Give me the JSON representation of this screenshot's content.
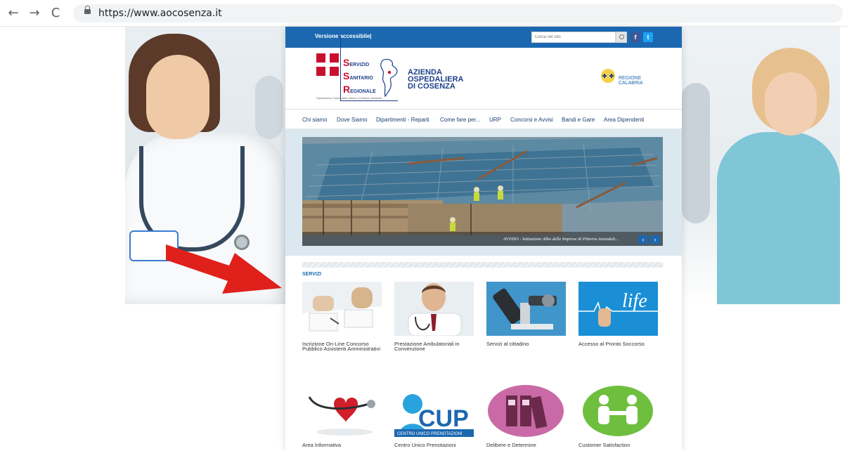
{
  "browser": {
    "url": "https://www.aocosenza.it",
    "back_icon": "←",
    "forward_icon": "→",
    "reload_icon": "C"
  },
  "topbar": {
    "accessible_link": "Versione accessibile|",
    "search_placeholder": "Cerca nel sito",
    "facebook_glyph": "f",
    "twitter_glyph": "t"
  },
  "header": {
    "ssr": {
      "line1_initial": "S",
      "line1_rest": "ERVIZIO",
      "line2_initial": "S",
      "line2_rest": "ANITARIO",
      "line3_initial": "R",
      "line3_rest": "EGIONALE",
      "subtitle": "Dipartimento Tutela della Salute e Politiche Sanitarie"
    },
    "azienda": [
      "AZIENDA",
      "OSPEDALIERA",
      "DI COSENZA"
    ],
    "regione": [
      "REGIONE",
      "CALABRIA"
    ]
  },
  "menu": [
    "Chi siamo",
    "Dove Siamo",
    "Dipartimenti - Reparti",
    "Come fare per...",
    "URP",
    "Concorsi e Avvisi",
    "Bandi e Gare",
    "Area Dipendenti"
  ],
  "slider": {
    "caption": "AVVISO - Istituzione Albo delle Imprese di Pittoria Aziendali...",
    "prev_glyph": "‹",
    "next_glyph": "›"
  },
  "services": {
    "title": "SERVIZI",
    "items": [
      {
        "label": "Iscrizione On-Line Concorso Pubblico Assistenti Amministrativi",
        "icon": "documents-signing-icon"
      },
      {
        "label": "Prestazione Ambulatoriali in Convenzione",
        "icon": "doctor-portrait-icon"
      },
      {
        "label": "Servizi al cittadino",
        "icon": "microscope-icon"
      },
      {
        "label": "Accesso al Pronto Soccorso",
        "icon": "life-heartbeat-icon"
      },
      {
        "label": "Area Informativa",
        "icon": "heart-stethoscope-icon"
      },
      {
        "label": "Centro Unico Prenotazioni",
        "icon": "cup-logo-icon"
      },
      {
        "label": "Delibere e Determine",
        "icon": "binders-icon"
      },
      {
        "label": "Customer Satisfaction",
        "icon": "handshake-icon"
      }
    ],
    "cup_text": "CUP",
    "cup_subtext": "CENTRO UNICO PRENOTAZIONI",
    "life_text": "life"
  },
  "colors": {
    "brand_blue": "#1c68b0",
    "ssr_red": "#c8102e",
    "arrow_red": "#e0201b"
  }
}
